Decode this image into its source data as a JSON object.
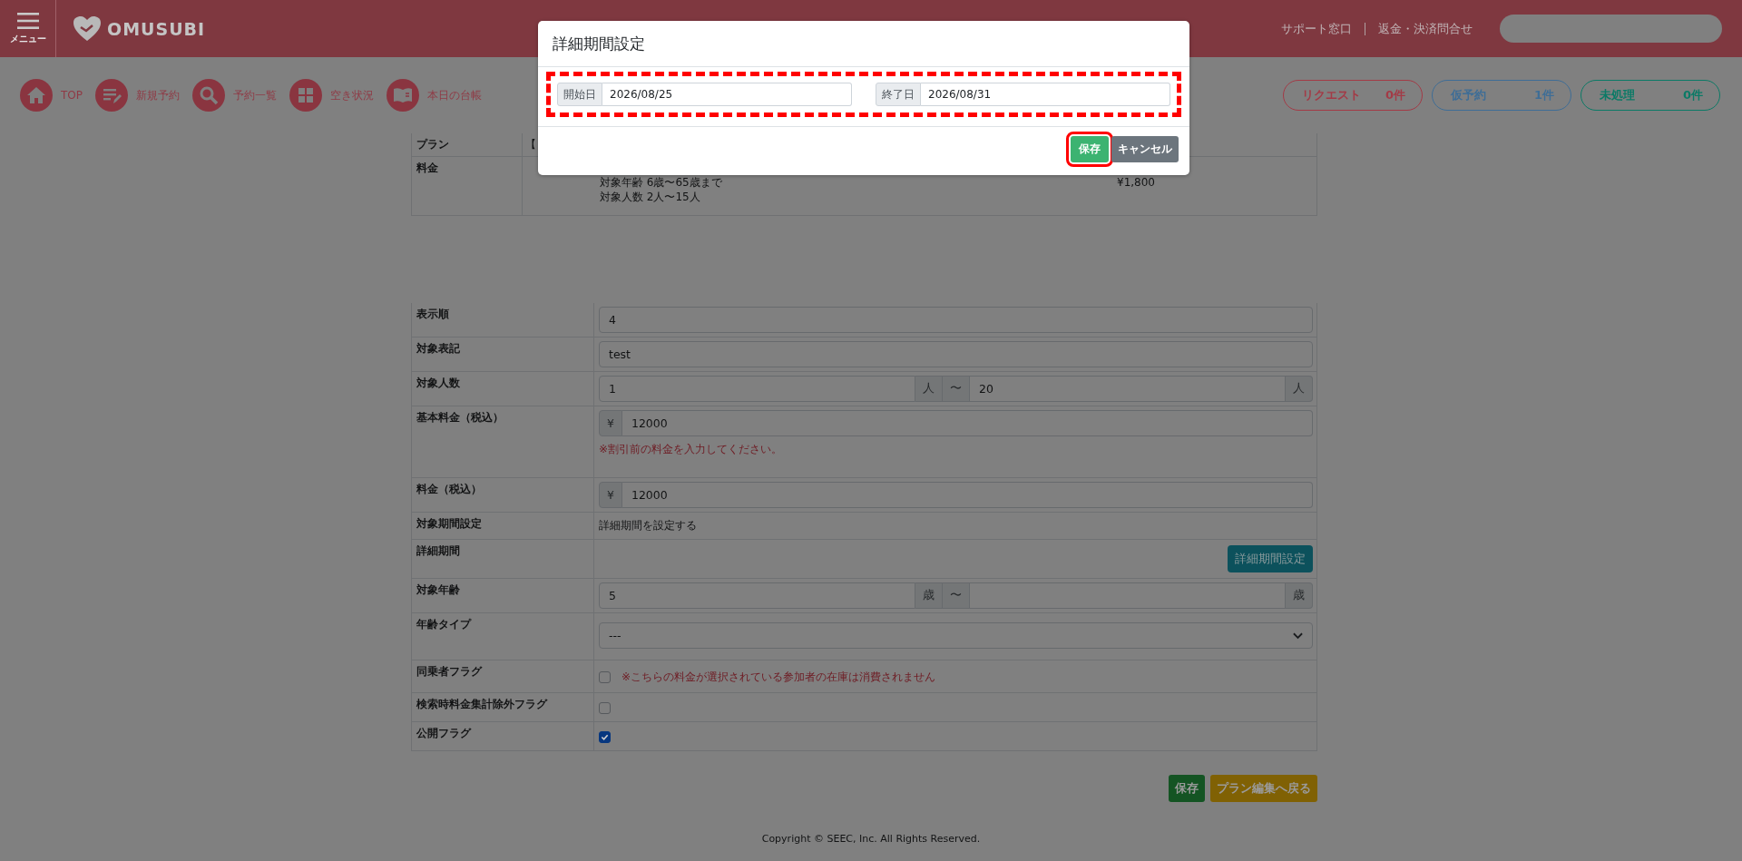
{
  "header": {
    "menu_label": "メニュー",
    "logo": "OMUSUBI",
    "links": [
      "サポート窓口",
      "返金・決済問合せ"
    ]
  },
  "nav": [
    {
      "label": "TOP"
    },
    {
      "label": "新規予約"
    },
    {
      "label": "予約一覧"
    },
    {
      "label": "空き状況"
    },
    {
      "label": "本日の台帳"
    }
  ],
  "counters": [
    {
      "label": "リクエスト",
      "count": "0件",
      "color": "#a33a46"
    },
    {
      "label": "仮予約",
      "count": "1件",
      "color": "#3e6d96"
    },
    {
      "label": "未処理",
      "count": "0件",
      "color": "#0b7a66"
    }
  ],
  "plan_summary": {
    "plan_label": "プラン",
    "plan_value": "【",
    "price_label": "料金",
    "lines": [
      "対象年齢 6歳〜65歳まで",
      "対象人数 2人〜15人"
    ],
    "price": "¥1,800"
  },
  "form": {
    "rows": [
      {
        "kind": "text",
        "label": "表示順",
        "value": "4"
      },
      {
        "kind": "text",
        "label": "対象表記",
        "value": "test"
      },
      {
        "kind": "range",
        "label": "対象人数",
        "from": "1",
        "unit_from": "人",
        "separator": "〜",
        "to": "20",
        "unit_to": "人"
      },
      {
        "kind": "currency",
        "label": "基本料金（税込）",
        "prefix": "¥",
        "value": "12000",
        "note": "※割引前の料金を入力してください。"
      },
      {
        "kind": "currency",
        "label": "料金（税込）",
        "prefix": "¥",
        "value": "12000"
      },
      {
        "kind": "static",
        "label": "対象期間設定",
        "text": "詳細期間を設定する"
      },
      {
        "kind": "button",
        "label": "詳細期間",
        "button": "詳細期間設定"
      },
      {
        "kind": "range",
        "label": "対象年齢",
        "from": "5",
        "unit_from": "歳",
        "separator": "〜",
        "unit_to": "歳"
      },
      {
        "kind": "select",
        "label": "年齢タイプ",
        "value": "---"
      },
      {
        "kind": "checkbox",
        "label": "同乗者フラグ",
        "checked": false,
        "note": "※こちらの料金が選択されている参加者の在庫は消費されません"
      },
      {
        "kind": "checkbox",
        "label": "検索時料金集計除外フラグ",
        "checked": false
      },
      {
        "kind": "checkbox",
        "label": "公開フラグ",
        "checked": true
      }
    ]
  },
  "actions": [
    {
      "label": "保存",
      "kind": "save"
    },
    {
      "label": "プラン編集へ戻る",
      "kind": "back"
    }
  ],
  "footer": "Copyright © SEEC, Inc. All Rights Reserved.",
  "modal": {
    "title": "詳細期間設定",
    "fields_highlighted": true,
    "fields": [
      {
        "label": "開始日",
        "value": "2026/08/25"
      },
      {
        "label": "終了日",
        "value": "2026/08/31"
      }
    ],
    "buttons": [
      {
        "label": "保存",
        "kind": "primary",
        "highlighted": true
      },
      {
        "label": "キャンセル",
        "kind": "secondary",
        "highlighted": false
      }
    ]
  }
}
